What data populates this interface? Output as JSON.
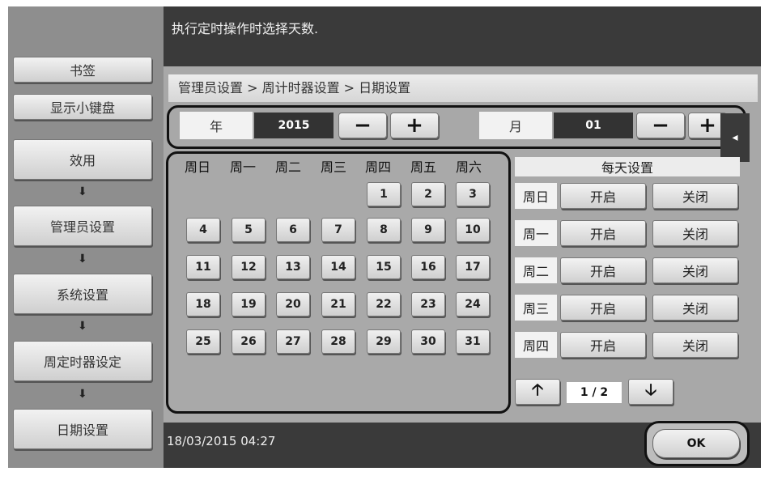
{
  "message": "执行定时操作时选择天数.",
  "sidebar": {
    "bookmark": "书签",
    "keypad": "显示小键盘",
    "steps": [
      "效用",
      "管理员设置",
      "系统设置",
      "周定时器设定",
      "日期设置"
    ],
    "arrow": "⬇"
  },
  "breadcrumb": "管理员设置 > 周计时器设置 > 日期设置",
  "year": {
    "label": "年",
    "value": "2015"
  },
  "month": {
    "label": "月",
    "value": "01"
  },
  "controls": {
    "minus": "−",
    "plus": "+",
    "side_tab": "◂"
  },
  "calendar": {
    "weekdays": [
      "周日",
      "周一",
      "周二",
      "周三",
      "周四",
      "周五",
      "周六"
    ],
    "days": [
      "1",
      "2",
      "3",
      "4",
      "5",
      "6",
      "7",
      "8",
      "9",
      "10",
      "11",
      "12",
      "13",
      "14",
      "15",
      "16",
      "17",
      "18",
      "19",
      "20",
      "21",
      "22",
      "23",
      "24",
      "25",
      "26",
      "27",
      "28",
      "29",
      "30",
      "31"
    ]
  },
  "daily": {
    "header": "每天设置",
    "rows": [
      {
        "day": "周日",
        "on": "开启",
        "off": "关闭"
      },
      {
        "day": "周一",
        "on": "开启",
        "off": "关闭"
      },
      {
        "day": "周二",
        "on": "开启",
        "off": "关闭"
      },
      {
        "day": "周三",
        "on": "开启",
        "off": "关闭"
      },
      {
        "day": "周四",
        "on": "开启",
        "off": "关闭"
      }
    ],
    "up": "🡡",
    "page": "1 / 2",
    "down": "🡣"
  },
  "status": {
    "datetime": "18/03/2015  04:27"
  },
  "ok_label": "OK"
}
